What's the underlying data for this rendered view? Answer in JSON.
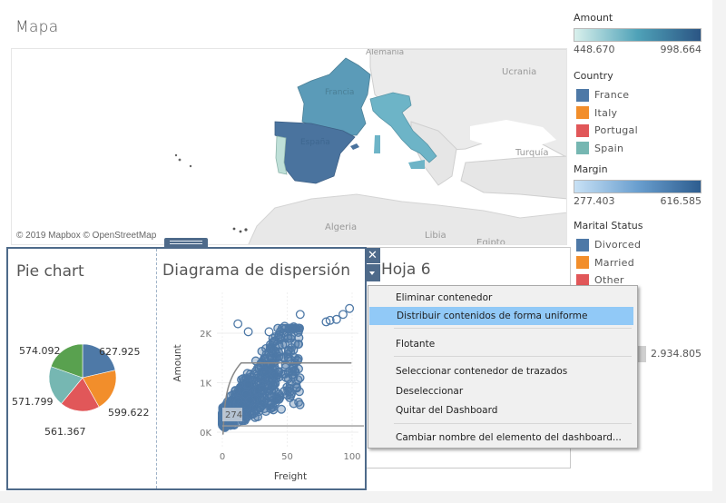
{
  "map": {
    "title": "Mapa",
    "attribution": "© 2019 Mapbox © OpenStreetMap",
    "place_labels": [
      "Alemania",
      "Francia",
      "Ucrania",
      "España",
      "Turquía",
      "Algeria",
      "Libia",
      "Egipto"
    ],
    "region_colors": {
      "France": "#5b9bb8",
      "Spain": "#4a739e",
      "Portugal": "#bfe0d8",
      "Italy": "#6db4c7"
    }
  },
  "legends": {
    "amount": {
      "title": "Amount",
      "min": "448.670",
      "max": "998.664",
      "from_color": "#d9f0ec",
      "to_color": "#2b5584"
    },
    "country": {
      "title": "Country",
      "items": [
        {
          "label": "France",
          "color": "#4e79a7"
        },
        {
          "label": "Italy",
          "color": "#f28e2b"
        },
        {
          "label": "Portugal",
          "color": "#e15759"
        },
        {
          "label": "Spain",
          "color": "#76b7b2"
        }
      ]
    },
    "margin": {
      "title": "Margin",
      "min": "277.403",
      "max": "616.585",
      "from_color": "#c8e1f5",
      "to_color": "#2d5d8f"
    },
    "marital_status": {
      "title": "Marital Status",
      "items": [
        {
          "label": "Divorced",
          "color": "#4e79a7"
        },
        {
          "label": "Married",
          "color": "#f28e2b"
        },
        {
          "label": "Other",
          "color": "#e15759"
        }
      ]
    },
    "size_value": "2.934.805"
  },
  "pie": {
    "title": "Pie chart",
    "slices": [
      {
        "label": "627.925",
        "value": 627.925,
        "color": "#4e79a7"
      },
      {
        "label": "599.622",
        "value": 599.622,
        "color": "#f28e2b"
      },
      {
        "label": "561.367",
        "value": 561.367,
        "color": "#e15759"
      },
      {
        "label": "571.799",
        "value": 571.799,
        "color": "#76b7b2"
      },
      {
        "label": "574.092",
        "value": 574.092,
        "color": "#59a14f"
      }
    ]
  },
  "scatter": {
    "title": "Diagrama de dispersión",
    "xlabel": "Freight",
    "ylabel": "Amount",
    "x_ticks": [
      "0",
      "50",
      "100"
    ],
    "y_ticks": [
      "0K",
      "1K",
      "2K"
    ],
    "reference_label": "274",
    "point_color": "#4e79a7"
  },
  "sheet6": {
    "title": "Hoja 6"
  },
  "controls": {
    "close_glyph": "✕"
  },
  "context_menu": {
    "items": [
      {
        "label": "Eliminar contenedor",
        "highlighted": false
      },
      {
        "label": "Distribuir contenidos de forma uniforme",
        "highlighted": true
      },
      {
        "label": "Flotante",
        "highlighted": false
      },
      {
        "label": "Seleccionar contenedor de trazados",
        "highlighted": false
      },
      {
        "label": "Deseleccionar",
        "highlighted": false
      },
      {
        "label": "Quitar del Dashboard",
        "highlighted": false
      },
      {
        "label": "Cambiar nombre del elemento del dashboard...",
        "highlighted": false
      }
    ]
  }
}
